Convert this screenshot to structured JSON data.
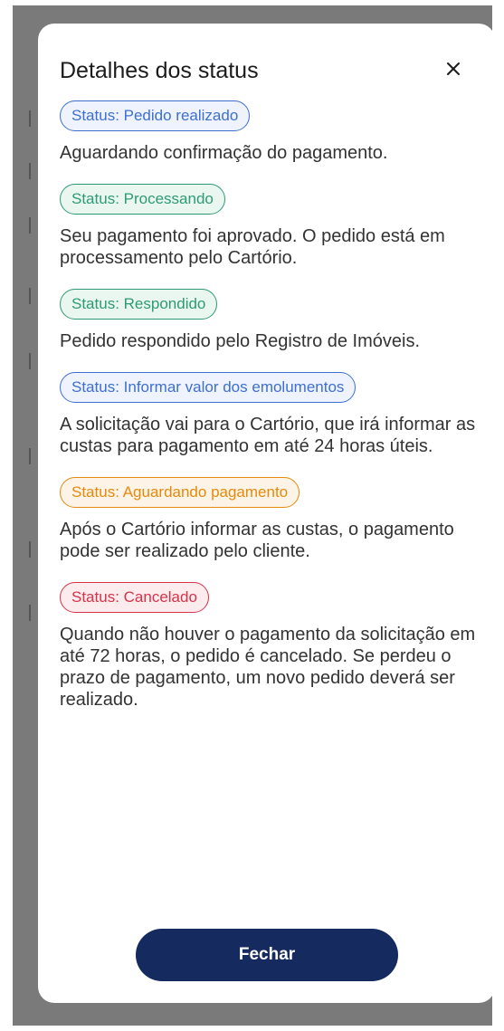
{
  "modal": {
    "title": "Detalhes dos status",
    "close_icon": "close-icon",
    "statuses": [
      {
        "label": "Status: Pedido realizado",
        "description": "Aguardando confirmação do pagamento.",
        "color": "#3f6fd1",
        "bg": "#eef3fd"
      },
      {
        "label": "Status: Processando",
        "description": "Seu pagamento foi aprovado. O pedido está em processamento pelo Cartório.",
        "color": "#2e9a77",
        "bg": "#eaf7f1"
      },
      {
        "label": "Status: Respondido",
        "description": "Pedido respondido pelo Registro de Imóveis.",
        "color": "#2e9a77",
        "bg": "#eaf7f1"
      },
      {
        "label": "Status: Informar valor dos emolumentos",
        "description": "A solicitação vai para o Cartório, que irá informar as custas para pagamento em até 24 horas úteis.",
        "color": "#3f6fd1",
        "bg": "#eef3fd"
      },
      {
        "label": "Status: Aguardando pagamento",
        "description": "Após o Cartório informar as custas, o pagamento pode ser realizado pelo cliente.",
        "color": "#e58a0c",
        "bg": "#fdf3e6"
      },
      {
        "label": "Status: Cancelado",
        "description": "Quando não houver o pagamento da solicitação em até 72 horas, o pedido é cancelado. Se perdeu o prazo de pagamento, um novo pedido deverá ser realizado.",
        "color": "#d6334a",
        "bg": "#fdecee"
      }
    ],
    "close_button_label": "Fechar",
    "button_color": "#152a5e"
  }
}
